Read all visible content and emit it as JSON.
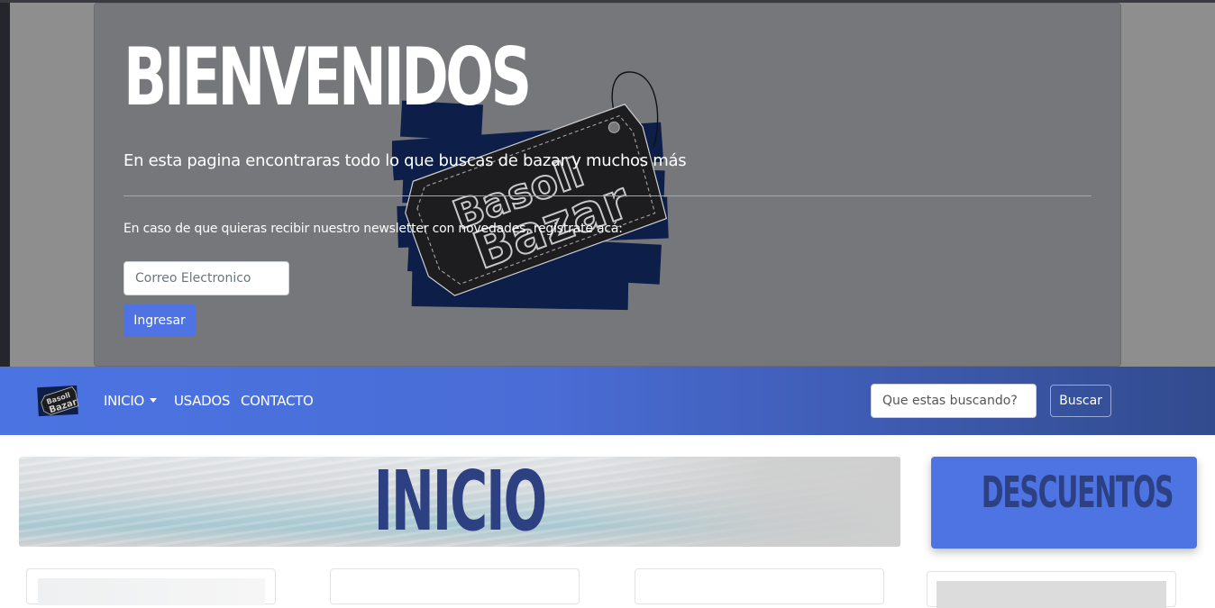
{
  "hero": {
    "title": "BIENVENIDOS",
    "subtitle": "En esta pagina encontraras todo lo que buscas de bazar y muchos más",
    "newsletter_text": "En caso de que quieras recibir nuestro newsletter con novedades, registrate acá:",
    "email_placeholder": "Correo Electronico",
    "submit_label": "Ingresar",
    "logo_text": "Basoll Bazar"
  },
  "navbar": {
    "items": [
      {
        "label": "INICIO",
        "has_dropdown": true
      },
      {
        "label": "USADOS"
      },
      {
        "label": "CONTACTO"
      }
    ],
    "search_placeholder": "Que estas buscando?",
    "search_button": "Buscar",
    "colors": {
      "gradient_start": "#4b74e2",
      "gradient_end": "#324b8e"
    }
  },
  "main": {
    "banner_title": "INICIO",
    "discounts_title": "DESCUENTOS"
  },
  "colors": {
    "accent": "#4f73e3",
    "heading": "#2c4082",
    "hero_bg": "#76777a"
  }
}
